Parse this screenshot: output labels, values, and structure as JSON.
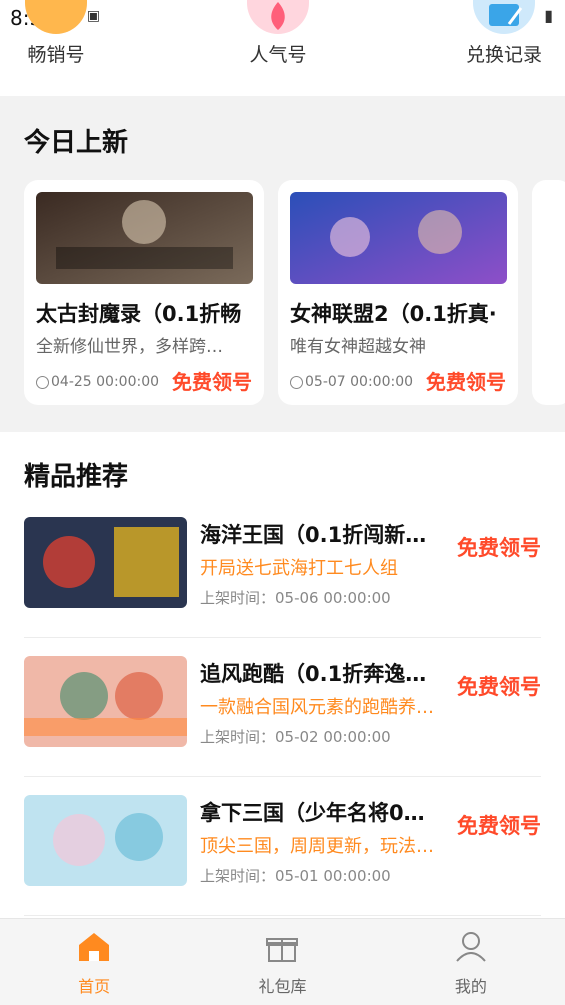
{
  "status_bar": {
    "time": "8:51"
  },
  "quick_links": [
    {
      "label": "畅销号",
      "icon": "hot-sale-icon",
      "color": "#ffb74d"
    },
    {
      "label": "人气号",
      "icon": "popularity-flame-icon",
      "color": "#ff5f7a"
    },
    {
      "label": "兑换记录",
      "icon": "exchange-record-icon",
      "color": "#3aa5e8"
    }
  ],
  "today_new": {
    "title": "今日上新",
    "cards": [
      {
        "name": "太古封魔录（0.1折畅",
        "desc": "全新修仙世界，多样跨…",
        "time": "04-25 00:00:00",
        "button": "免费领号"
      },
      {
        "name": "女神联盟2（0.1折真·",
        "desc": "唯有女神超越女神",
        "time": "05-07 00:00:00",
        "button": "免费领号"
      }
    ]
  },
  "recommend": {
    "title": "精品推荐",
    "items": [
      {
        "name": "海洋王国（0.1折闯新…",
        "desc": "开局送七武海打工七人组",
        "time": "上架时间：05-06 00:00:00",
        "button": "免费领号"
      },
      {
        "name": "追风跑酷（0.1折奔逸…",
        "desc": "一款融合国风元素的跑酷养…",
        "time": "上架时间：05-02 00:00:00",
        "button": "免费领号"
      },
      {
        "name": "拿下三国（少年名将0.…",
        "desc": "顶尖三国，周周更新，玩法…",
        "time": "上架时间：05-01 00:00:00",
        "button": "免费领号"
      }
    ]
  },
  "nav": {
    "tabs": [
      {
        "label": "首页",
        "icon": "home-icon",
        "active": true
      },
      {
        "label": "礼包库",
        "icon": "gift-icon",
        "active": false
      },
      {
        "label": "我的",
        "icon": "user-icon",
        "active": false
      }
    ]
  },
  "colors": {
    "accent": "#ff8a1f",
    "cta": "#ff4a2a",
    "background": "#f2f2f2"
  }
}
